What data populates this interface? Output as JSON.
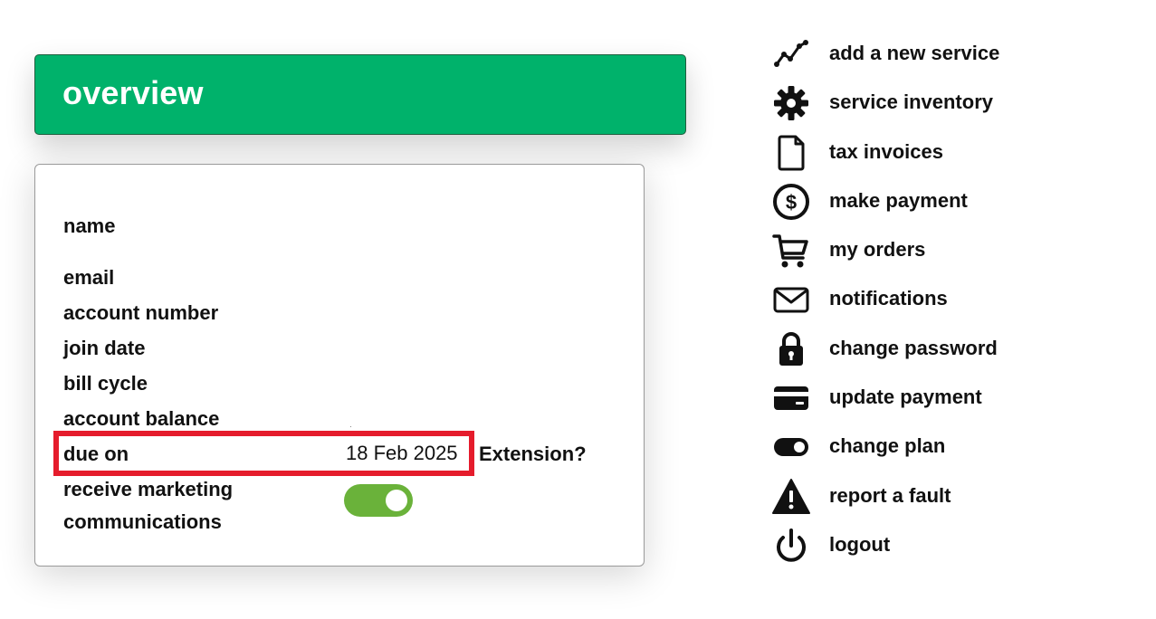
{
  "colors": {
    "accent": "#00b26b",
    "toggle": "#6ab23a",
    "highlight": "#e51c2c"
  },
  "header": {
    "title": "overview"
  },
  "account": {
    "name_label": "name",
    "email_label": "email",
    "account_number_label": "account number",
    "join_date_label": "join date",
    "bill_cycle_label": "bill cycle",
    "account_balance_label": "account balance",
    "due_on_label": "due on",
    "due_on_value": "18 Feb 2025",
    "extension_label": "Extension?",
    "marketing_label_line1": "receive marketing",
    "marketing_label_line2": "communications",
    "marketing_enabled": true
  },
  "menu": {
    "items": [
      {
        "label": "add a new service",
        "icon": "trend-line-icon"
      },
      {
        "label": "service inventory",
        "icon": "gear-icon"
      },
      {
        "label": "tax invoices",
        "icon": "document-icon"
      },
      {
        "label": "make payment",
        "icon": "dollar-circle-icon"
      },
      {
        "label": "my orders",
        "icon": "cart-icon"
      },
      {
        "label": "notifications",
        "icon": "envelope-icon"
      },
      {
        "label": "change password",
        "icon": "lock-icon"
      },
      {
        "label": "update payment",
        "icon": "credit-card-icon"
      },
      {
        "label": "change plan",
        "icon": "toggle-icon"
      },
      {
        "label": "report a fault",
        "icon": "warning-icon"
      },
      {
        "label": "logout",
        "icon": "power-icon"
      }
    ]
  }
}
